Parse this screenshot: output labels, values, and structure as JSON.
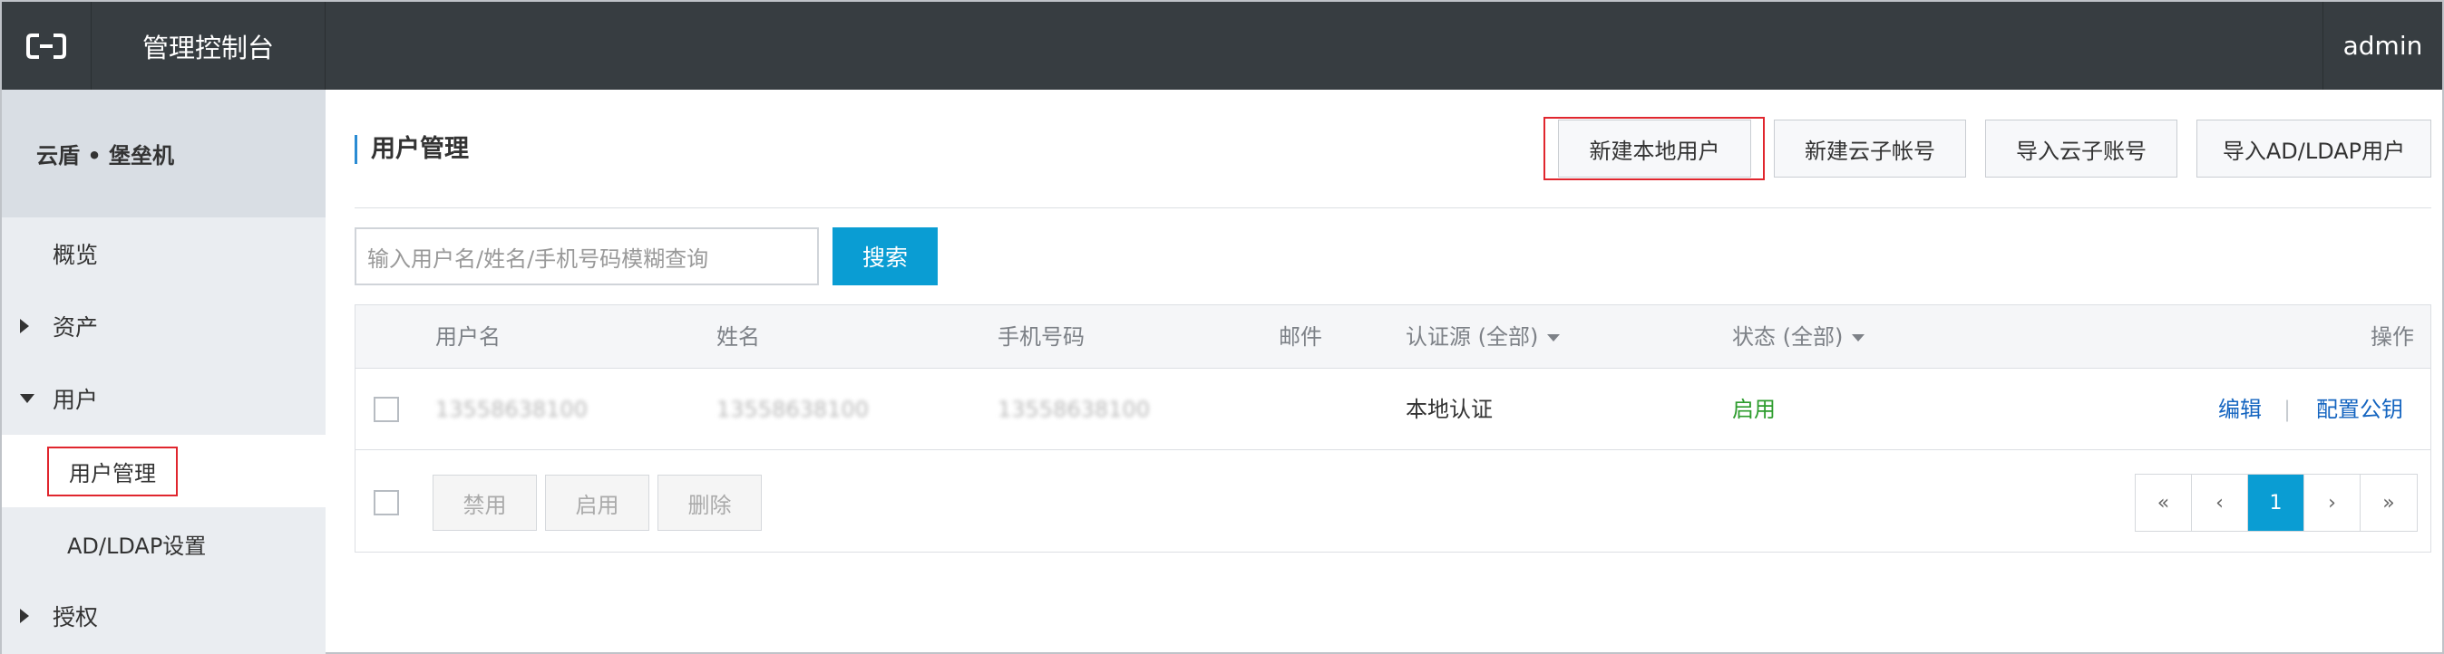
{
  "header": {
    "logo_icon": "aliyun-logo-icon",
    "console_title": "管理控制台",
    "user": "admin"
  },
  "sidebar": {
    "product_name": "云盾 • 堡垒机",
    "items": [
      {
        "label": "概览"
      },
      {
        "label": "资产"
      },
      {
        "label": "用户"
      },
      {
        "label": "用户管理"
      },
      {
        "label": "AD/LDAP设置"
      },
      {
        "label": "授权"
      }
    ]
  },
  "main": {
    "page_title": "用户管理",
    "buttons": {
      "new_local_user": "新建本地用户",
      "new_cloud_sub_account": "新建云子帐号",
      "import_cloud_sub_account": "导入云子账号",
      "import_ad_ldap_user": "导入AD/LDAP用户"
    },
    "search": {
      "placeholder": "输入用户名/姓名/手机号码模糊查询",
      "button": "搜索"
    },
    "table": {
      "headers": {
        "username": "用户名",
        "name": "姓名",
        "phone": "手机号码",
        "email": "邮件",
        "auth_source": "认证源 (全部)",
        "status": "状态 (全部)",
        "actions": "操作"
      },
      "rows": [
        {
          "username": "13558638100",
          "name": "13558638100",
          "phone": "13558638100",
          "email": "",
          "auth_source": "本地认证",
          "status": "启用",
          "action_edit": "编辑",
          "action_separator": "|",
          "action_config_key": "配置公钥"
        }
      ]
    },
    "bulk_actions": {
      "disable": "禁用",
      "enable": "启用",
      "delete": "删除"
    },
    "pagination": {
      "first": "«",
      "prev": "‹",
      "current": "1",
      "next": "›",
      "last": "»"
    }
  },
  "colors": {
    "header_bg": "#373d41",
    "sidebar_bg": "#eaedf1",
    "accent": "#0a9dd3",
    "highlight": "#e0262e",
    "status_on": "#2c9c2c",
    "link": "#1565c0"
  }
}
